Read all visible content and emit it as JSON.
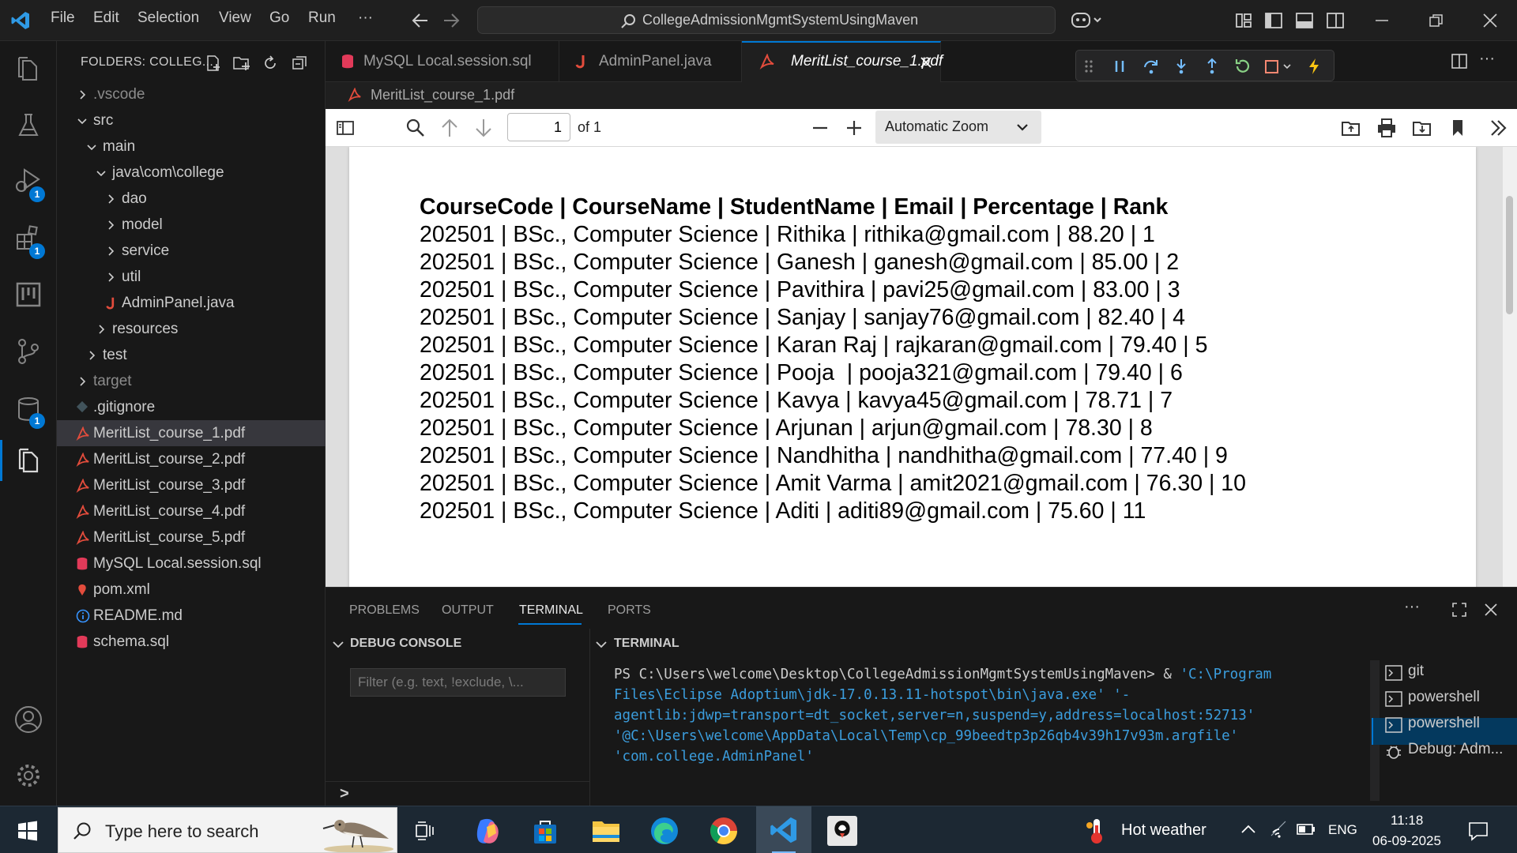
{
  "titlebar": {
    "menu": [
      "File",
      "Edit",
      "Selection",
      "View",
      "Go",
      "Run"
    ],
    "more": "···",
    "command_center": "CollegeAdmissionMgmtSystemUsingMaven"
  },
  "activitybar": {
    "badges": [
      "1",
      "1",
      "1"
    ]
  },
  "sidebar": {
    "title": "FOLDERS: COLLEG...",
    "tree": [
      {
        "label": ".vscode",
        "kind": "folder",
        "open": false,
        "dim": true,
        "depth": 0
      },
      {
        "label": "src",
        "kind": "folder",
        "open": true,
        "dim": false,
        "depth": 0
      },
      {
        "label": "main",
        "kind": "folder",
        "open": true,
        "dim": false,
        "depth": 1
      },
      {
        "label": "java\\com\\college",
        "kind": "folder",
        "open": true,
        "dim": false,
        "depth": 2
      },
      {
        "label": "dao",
        "kind": "folder",
        "open": false,
        "dim": false,
        "depth": 3
      },
      {
        "label": "model",
        "kind": "folder",
        "open": false,
        "dim": false,
        "depth": 3
      },
      {
        "label": "service",
        "kind": "folder",
        "open": false,
        "dim": false,
        "depth": 3
      },
      {
        "label": "util",
        "kind": "folder",
        "open": false,
        "dim": false,
        "depth": 3
      },
      {
        "label": "AdminPanel.java",
        "kind": "java",
        "dim": false,
        "depth": 3
      },
      {
        "label": "resources",
        "kind": "folder",
        "open": false,
        "dim": false,
        "depth": 2
      },
      {
        "label": "test",
        "kind": "folder",
        "open": false,
        "dim": false,
        "depth": 1
      },
      {
        "label": "target",
        "kind": "folder",
        "open": false,
        "dim": true,
        "depth": 0
      },
      {
        "label": ".gitignore",
        "kind": "git",
        "dim": false,
        "depth": 0
      },
      {
        "label": "MeritList_course_1.pdf",
        "kind": "pdf",
        "dim": false,
        "depth": 0,
        "selected": true
      },
      {
        "label": "MeritList_course_2.pdf",
        "kind": "pdf",
        "dim": false,
        "depth": 0
      },
      {
        "label": "MeritList_course_3.pdf",
        "kind": "pdf",
        "dim": false,
        "depth": 0
      },
      {
        "label": "MeritList_course_4.pdf",
        "kind": "pdf",
        "dim": false,
        "depth": 0
      },
      {
        "label": "MeritList_course_5.pdf",
        "kind": "pdf",
        "dim": false,
        "depth": 0
      },
      {
        "label": "MySQL Local.session.sql",
        "kind": "sql",
        "dim": false,
        "depth": 0
      },
      {
        "label": "pom.xml",
        "kind": "xml",
        "dim": false,
        "depth": 0
      },
      {
        "label": "README.md",
        "kind": "info",
        "dim": false,
        "depth": 0
      },
      {
        "label": "schema.sql",
        "kind": "sql",
        "dim": false,
        "depth": 0
      }
    ]
  },
  "editor": {
    "tabs": [
      {
        "label": "MySQL Local.session.sql",
        "kind": "sql",
        "active": false
      },
      {
        "label": "AdminPanel.java",
        "kind": "java",
        "active": false
      },
      {
        "label": "MeritList_course_1.pdf",
        "kind": "pdf",
        "active": true
      }
    ],
    "breadcrumb": "MeritList_course_1.pdf"
  },
  "pdf": {
    "page_number": "1",
    "page_total": "of 1",
    "zoom": "Automatic Zoom",
    "header": "CourseCode | CourseName | StudentName | Email | Percentage | Rank",
    "rows": [
      "202501 | BSc., Computer Science | Rithika | rithika@gmail.com | 88.20 | 1",
      "202501 | BSc., Computer Science | Ganesh | ganesh@gmail.com | 85.00 | 2",
      "202501 | BSc., Computer Science | Pavithira | pavi25@gmail.com | 83.00 | 3",
      "202501 | BSc., Computer Science | Sanjay | sanjay76@gmail.com | 82.40 | 4",
      "202501 | BSc., Computer Science | Karan Raj | rajkaran@gmail.com | 79.40 | 5",
      "202501 | BSc., Computer Science | Pooja  | pooja321@gmail.com | 79.40 | 6",
      "202501 | BSc., Computer Science | Kavya | kavya45@gmail.com | 78.71 | 7",
      "202501 | BSc., Computer Science | Arjunan | arjun@gmail.com | 78.30 | 8",
      "202501 | BSc., Computer Science | Nandhitha | nandhitha@gmail.com | 77.40 | 9",
      "202501 | BSc., Computer Science | Amit Varma | amit2021@gmail.com | 76.30 | 10",
      "202501 | BSc., Computer Science | Aditi | aditi89@gmail.com | 75.60 | 11"
    ]
  },
  "panel": {
    "tabs": [
      "PROBLEMS",
      "OUTPUT",
      "TERMINAL",
      "PORTS"
    ],
    "active_tab": "TERMINAL",
    "more": "···",
    "debug_console_title": "DEBUG CONSOLE",
    "filter_placeholder": "Filter (e.g. text, !exclude, \\...",
    "terminal_title": "TERMINAL",
    "prompt": "PS C:\\Users\\welcome\\Desktop\\CollegeAdmissionMgmtSystemUsingMaven>  & ",
    "command_parts": [
      "'C:\\Program Files\\Eclipse Adoptium\\jdk-17.0.13.11-hotspot\\bin\\java.exe'",
      " '-agentlib:jdwp=transport=dt_socket,server=n,suspend=y,address=localhost:52713'",
      " '@C:\\Users\\welcome\\AppData\\Local\\Temp\\cp_99beedtp3p26qb4v39h17v93m.argfile'",
      " 'com.college.AdminPanel'"
    ],
    "terminals": [
      "git",
      "powershell",
      "powershell",
      "Debug: Adm..."
    ],
    "input_prompt": ">"
  },
  "taskbar": {
    "search_placeholder": "Type here to search",
    "weather": "Hot weather",
    "language": "ENG",
    "time": "11:18",
    "date": "06-09-2025"
  },
  "colors": {
    "accent": "#0078d4",
    "pdf_icon": "#e34c3c",
    "sql_icon": "#e23a59",
    "terminal_string": "#3b9ddd"
  }
}
